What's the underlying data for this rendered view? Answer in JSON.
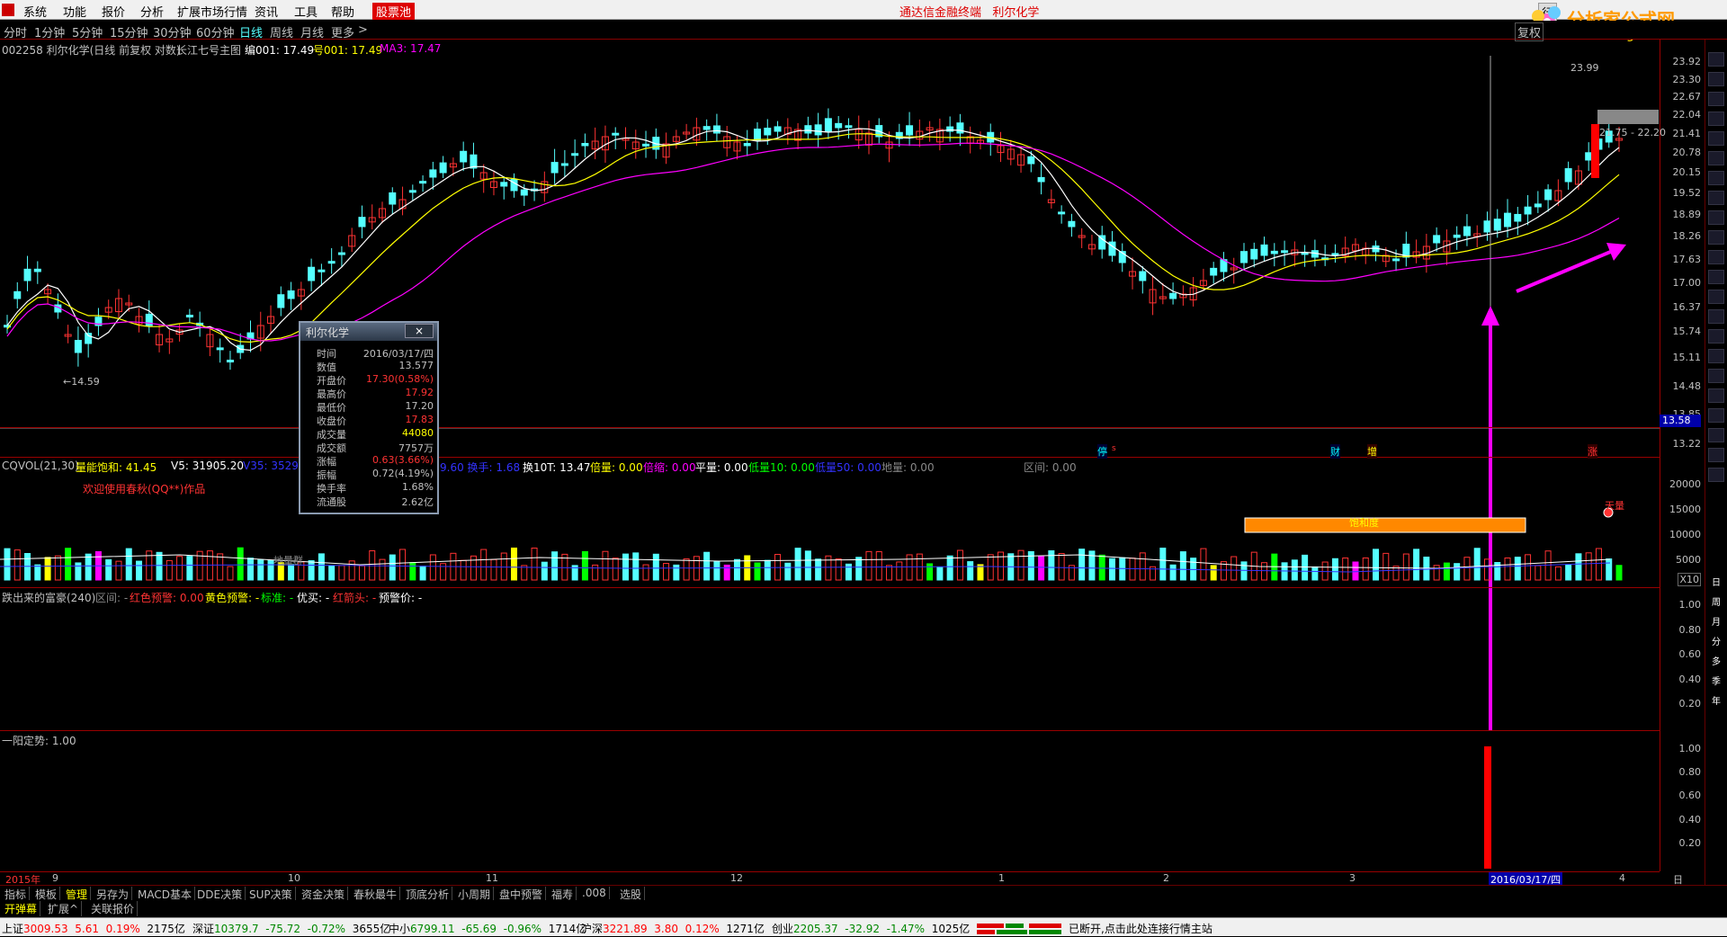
{
  "menubar": {
    "items": [
      "系统",
      "功能",
      "报价",
      "分析",
      "扩展市场行情",
      "资讯",
      "工具",
      "帮助",
      "股票池"
    ],
    "title": "通达信金融终端",
    "stock_name": "利尔化学",
    "right_btn": "行"
  },
  "logo": {
    "text": "分析家公式网",
    "url": "www.88gs.com"
  },
  "periods": {
    "items": [
      "分时",
      "1分钟",
      "5分钟",
      "15分钟",
      "30分钟",
      "60分钟",
      "日线",
      "周线",
      "月线",
      "更多"
    ],
    "active": "日线",
    "more_arrow": ">",
    "fuquan": "复权"
  },
  "infoline": {
    "code_name": "002258 利尔化学(日线 前复权 对数)",
    "formula": "长江七号主图",
    "bian": "编001: 17.49",
    "hao": "号001: 17.49",
    "ma3": "MA3: 17.47"
  },
  "main_axis": [
    "23.92",
    "23.30",
    "22.67",
    "22.04",
    "21.41",
    "20.78",
    "20.15",
    "19.52",
    "18.89",
    "18.26",
    "17.63",
    "17.00",
    "16.37",
    "15.74",
    "15.11",
    "14.48",
    "13.85",
    "13.22"
  ],
  "main_annotations": {
    "low_label": "←14.59",
    "high_label": "23.99",
    "range_label": "21.75 - 22.20",
    "current_price": "13.58",
    "markers": [
      "停",
      "财",
      "增",
      "涨"
    ]
  },
  "popup": {
    "title": "利尔化学",
    "close": "×",
    "rows": [
      {
        "k": "时间",
        "v": "2016/03/17/四",
        "c": ""
      },
      {
        "k": "数值",
        "v": "13.577",
        "c": ""
      },
      {
        "k": "开盘价",
        "v": "17.30(0.58%)",
        "c": "red"
      },
      {
        "k": "最高价",
        "v": "17.92",
        "c": "red"
      },
      {
        "k": "最低价",
        "v": "17.20",
        "c": ""
      },
      {
        "k": "收盘价",
        "v": "17.83",
        "c": "red"
      },
      {
        "k": "成交量",
        "v": "44080",
        "c": "yel"
      },
      {
        "k": "成交额",
        "v": "7757万",
        "c": ""
      },
      {
        "k": "涨幅",
        "v": "0.63(3.66%)",
        "c": "red"
      },
      {
        "k": "振幅",
        "v": "0.72(4.19%)",
        "c": ""
      },
      {
        "k": "换手率",
        "v": "1.68%",
        "c": ""
      },
      {
        "k": "流通股",
        "v": "2.62亿",
        "c": ""
      }
    ]
  },
  "vol_panel": {
    "name": "CQVOL(21,30)",
    "saturation_label": "量能饱和: 41.45",
    "v5": "V5: 31905.20",
    "v35_partial": "V35: 35297",
    "huanshou_partial": "9.60 换手: 1.68",
    "huan10t": "换10T: 13.47",
    "beiliang": "倍量: 0.00",
    "beisuo": "倍缩: 0.00",
    "pingliang": "平量: 0.00",
    "diliang10": "低量10: 0.00",
    "diliang50": "低量50: 0.00",
    "diliang": "地量: 0.00",
    "qujian": "区间: 0.00",
    "welcome": "欢迎使用春秋(QQ**)作品",
    "dilianqun": "地量群",
    "baohedu": "饱和度",
    "tianliang": "天量",
    "axis": [
      "20000",
      "15000",
      "10000",
      "5000",
      "X10"
    ]
  },
  "panel3": {
    "title": "跌出来的富豪(240)",
    "qujian": "区间: -",
    "red_alert": "红色预警: 0.00",
    "yellow_alert": "黄色预警: -",
    "standard": "标准: -",
    "excellent": "优买: -",
    "red_arrow": "红箭头: -",
    "alert_price": "预警价: -",
    "axis": [
      "1.00",
      "0.80",
      "0.60",
      "0.40",
      "0.20"
    ]
  },
  "panel4": {
    "title": "一阳定势: 1.00",
    "axis": [
      "1.00",
      "0.80",
      "0.60",
      "0.40",
      "0.20"
    ]
  },
  "datebar": {
    "labels": [
      "2015年",
      "9",
      "10",
      "11",
      "12",
      "1",
      "2",
      "3",
      "2016/03/17/四",
      "4"
    ],
    "period": "日线"
  },
  "right_toolbar": [
    "日",
    "周",
    "月",
    "分",
    "多",
    "季",
    "年"
  ],
  "tabs": [
    "指标",
    "模板",
    "管理",
    "另存为",
    "MACD基本",
    "DDE决策",
    "SUP决策",
    "资金决策",
    "春秋最牛",
    "顶底分析",
    "小周期",
    "盘中预警",
    "福寿",
    ".008",
    "选股"
  ],
  "tabs_active": "管理",
  "tabs2": [
    "开弹幕",
    "扩展^",
    "关联报价"
  ],
  "statusbar": {
    "sh_label": "上证",
    "sh_val": "3009.53",
    "sh_chg": "5.61",
    "sh_pct": "0.19%",
    "sh_amt": "2175亿",
    "sz_label": "深证",
    "sz_val": "10379.7",
    "sz_chg": "-75.72",
    "sz_pct": "-0.72%",
    "sz_amt": "3655亿",
    "zx_label": "中小",
    "zx_val": "6799.11",
    "zx_chg": "-65.69",
    "zx_pct": "-0.96%",
    "zx_amt": "1714亿",
    "hs_label": "沪深",
    "hs_val": "3221.89",
    "hs_chg": "3.80",
    "hs_pct": "0.12%",
    "hs_amt": "1271亿",
    "cy_label": "创业",
    "cy_val": "2205.37",
    "cy_chg": "-32.92",
    "cy_pct": "-1.47%",
    "cy_amt": "1025亿",
    "msg": "已断开,点击此处连接行情主站"
  }
}
